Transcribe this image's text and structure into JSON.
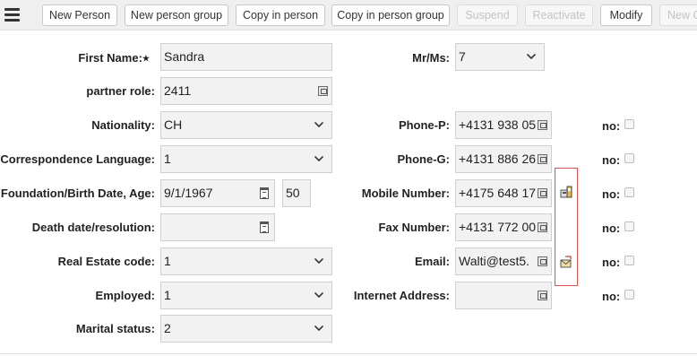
{
  "toolbar": {
    "buttons": [
      {
        "label": "New Person",
        "disabled": false
      },
      {
        "label": "New person group",
        "disabled": false
      },
      {
        "label": "Copy in person",
        "disabled": false
      },
      {
        "label": "Copy in person group",
        "disabled": false
      },
      {
        "label": "Suspend",
        "disabled": true
      },
      {
        "label": "Reactivate",
        "disabled": true
      },
      {
        "label": "Modify",
        "disabled": false
      },
      {
        "label": "New C",
        "disabled": true
      }
    ]
  },
  "form": {
    "first_name": {
      "label": "First Name:",
      "required_mark": "★",
      "value": "Sandra"
    },
    "partner_role": {
      "label": "partner role:",
      "value": "2411"
    },
    "nationality": {
      "label": "Nationality:",
      "value": "CH"
    },
    "correspondence_language": {
      "label": "Correspondence Language:",
      "value": "1"
    },
    "birth_date": {
      "label": "Foundation/Birth Date, Age:",
      "value": "9/1/1967",
      "age": "50"
    },
    "death_date": {
      "label": "Death date/resolution:",
      "value": ""
    },
    "real_estate_code": {
      "label": "Real Estate code:",
      "value": "1"
    },
    "employed": {
      "label": "Employed:",
      "value": "1"
    },
    "marital_status": {
      "label": "Marital status:",
      "value": "2"
    },
    "salutation": {
      "label": "Mr/Ms:",
      "value": "7"
    },
    "phone_p": {
      "label": "Phone-P:",
      "value": "+4131 938 05",
      "no_label": "no:"
    },
    "phone_g": {
      "label": "Phone-G:",
      "value": "+4131 886 26",
      "no_label": "no:"
    },
    "mobile": {
      "label": "Mobile Number:",
      "value": "+4175 648 17",
      "no_label": "no:"
    },
    "fax": {
      "label": "Fax Number:",
      "value": "+4131 772 00",
      "no_label": "no:"
    },
    "email": {
      "label": "Email:",
      "value": "Walti@test5.",
      "no_label": "no:"
    },
    "internet": {
      "label": "Internet Address:",
      "value": "",
      "no_label": "no:"
    }
  },
  "icons": {
    "mobile_action": "phone-device-icon",
    "email_action": "send-mail-icon",
    "lookup": "lookup-icon",
    "calendar": "calendar-icon",
    "chevron": "chevron-down-icon",
    "menu": "hamburger-menu-icon"
  },
  "colors": {
    "highlight_border": "#d9534f",
    "field_bg": "#f2f2f2",
    "toolbar_bg": "#efefef"
  }
}
